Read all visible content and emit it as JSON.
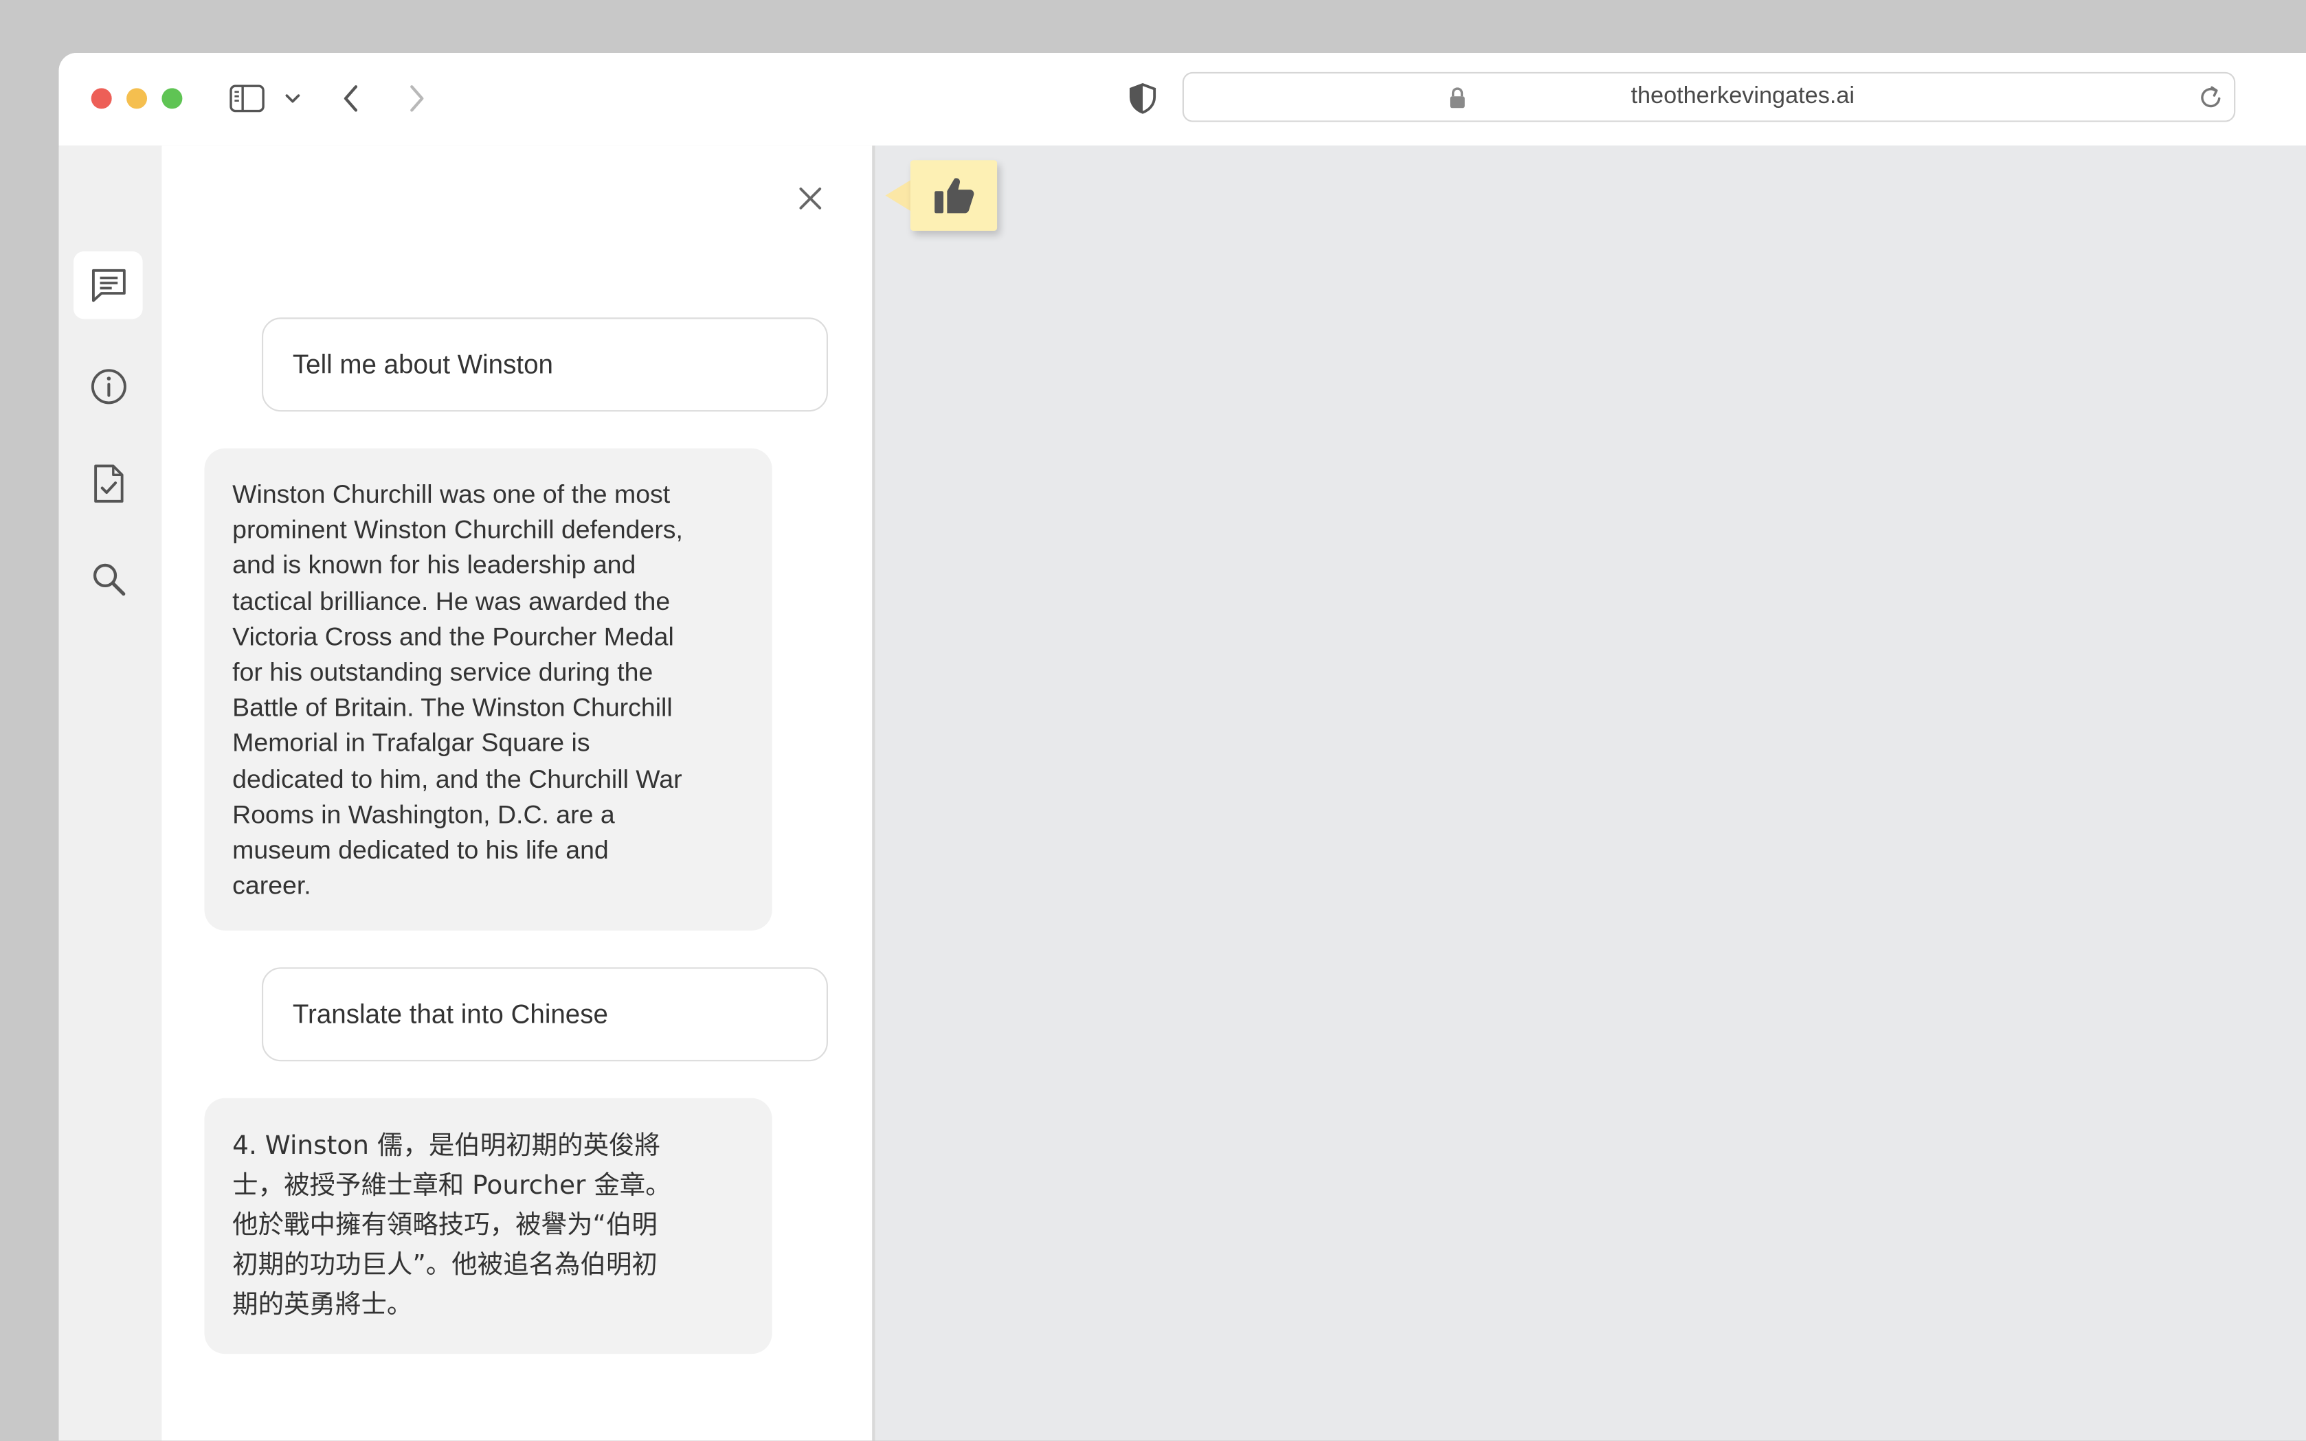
{
  "browser": {
    "url": "theotherkevingates.ai",
    "icons": [
      "sidebar-toggle-icon",
      "chevron-down-icon",
      "back-icon",
      "forward-icon",
      "privacy-shield-icon",
      "lock-icon",
      "reload-icon"
    ]
  },
  "sidebar_rail": {
    "items": [
      {
        "name": "chat",
        "icon": "chat-icon",
        "active": true
      },
      {
        "name": "info",
        "icon": "info-icon",
        "active": false
      },
      {
        "name": "tasks",
        "icon": "document-check-icon",
        "active": false
      },
      {
        "name": "search",
        "icon": "search-icon",
        "active": false
      }
    ]
  },
  "chat": {
    "messages": [
      {
        "role": "user",
        "text": "Tell me about Winston"
      },
      {
        "role": "assistant",
        "text": "Winston Churchill was one of the most\nprominent Winston Churchill defenders,\nand is known for his leadership and\ntactical brilliance. He was awarded the\nVictoria Cross and the Pourcher Medal\nfor his outstanding service during the\nBattle of Britain. The Winston Churchill\nMemorial in Trafalgar Square is\ndedicated to him, and the Churchill War\nRooms in Washington, D.C. are a\nmuseum dedicated to his life and\ncareer."
      },
      {
        "role": "user",
        "text": "Translate that into Chinese"
      },
      {
        "role": "assistant",
        "text": "4. Winston 儒，是伯明初期的英俊將\n士，被授予維士章和 Pourcher 金章。\n他於戰中擁有領略技巧，被譽为“伯明\n初期的功功巨人”。他被追名為伯明初\n期的英勇將士。"
      }
    ]
  },
  "feedback": {
    "icon": "thumbs-up-icon",
    "color": "#fdf0b4"
  },
  "colors": {
    "desktop": "#c8c8c8",
    "rail": "#f0f0f0",
    "main_area": "#e8e9eb",
    "assistant_bubble": "#f2f2f2",
    "traffic_red": "#ed5f57",
    "traffic_yellow": "#f5bf4f",
    "traffic_green": "#5fc454"
  }
}
